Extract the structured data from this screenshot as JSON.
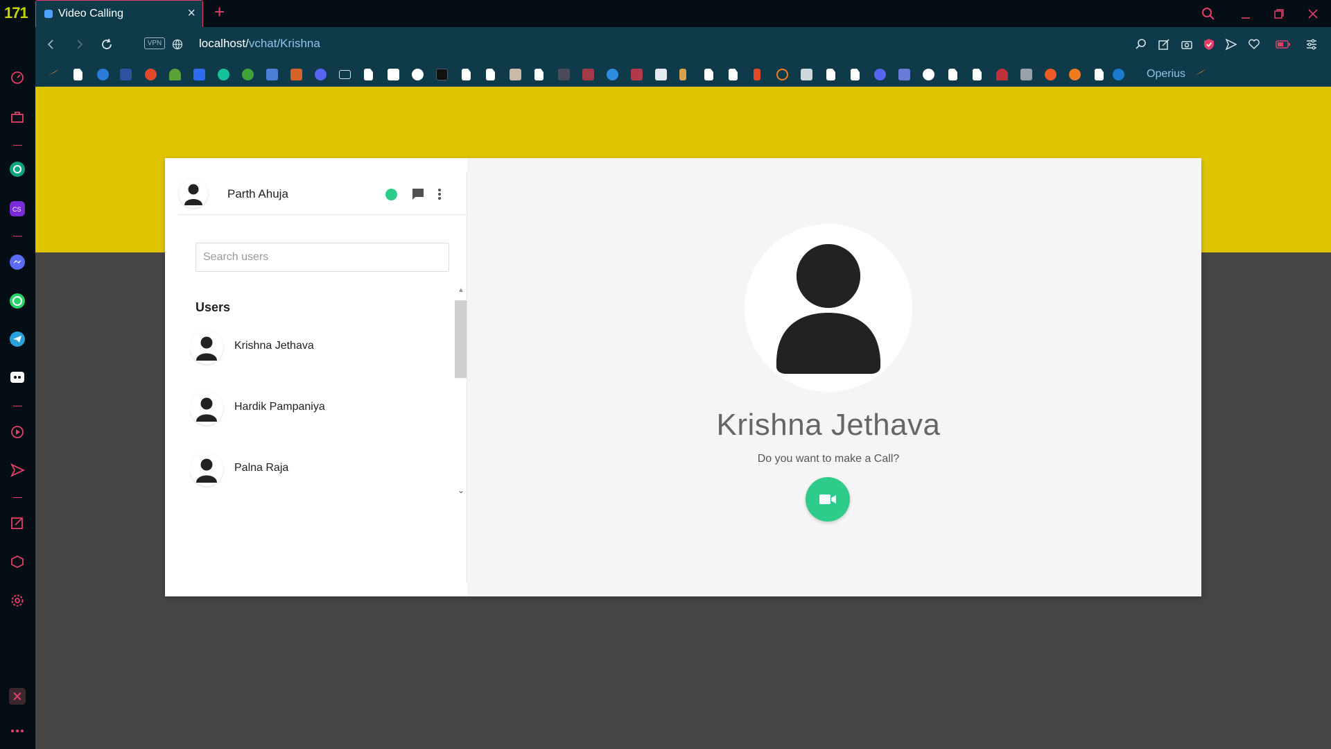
{
  "browser": {
    "logo_text": "171",
    "tab_title": "Video Calling",
    "vpn_label": "VPN",
    "url_host": "localhost/",
    "url_path": "vchat/Krishna",
    "bookmark_label": "Operius",
    "accent_color": "#e0406a"
  },
  "app": {
    "current_user": {
      "name": "Parth Ahuja",
      "status": "online",
      "status_color": "#2ecc8a"
    },
    "search": {
      "placeholder": "Search users",
      "value": ""
    },
    "users_heading": "Users",
    "users": [
      {
        "name": "Krishna Jethava"
      },
      {
        "name": "Hardik Pampaniya"
      },
      {
        "name": "Palna Raja"
      }
    ],
    "call_panel": {
      "callee_name": "Krishna Jethava",
      "prompt": "Do you want to make a Call?",
      "call_icon": "video-camera-icon",
      "button_color": "#2ecc8a"
    },
    "colors": {
      "page_top_band": "#dfc400",
      "page_background": "#474444"
    }
  }
}
